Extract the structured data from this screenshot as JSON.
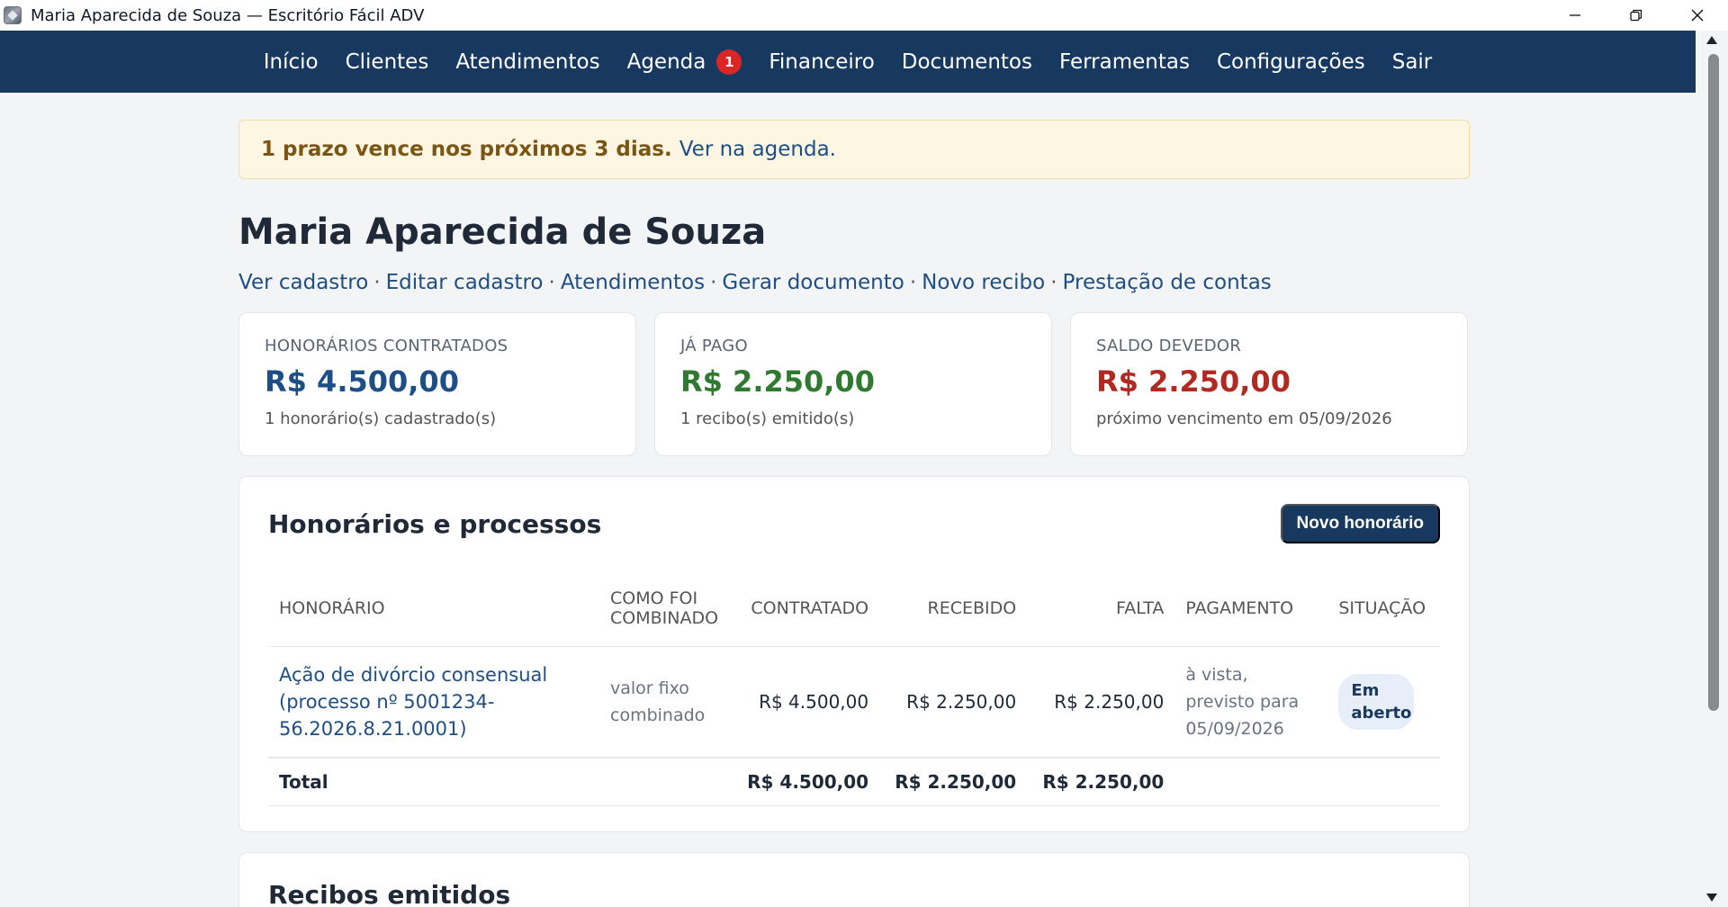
{
  "window": {
    "title": "Maria Aparecida de Souza — Escritório Fácil ADV"
  },
  "nav": {
    "items": [
      "Início",
      "Clientes",
      "Atendimentos",
      "Agenda",
      "Financeiro",
      "Documentos",
      "Ferramentas",
      "Configurações",
      "Sair"
    ],
    "agenda_badge": "1"
  },
  "alert": {
    "strong": "1 prazo vence nos próximos 3 dias.",
    "link": "Ver na agenda."
  },
  "client": {
    "name": "Maria Aparecida de Souza"
  },
  "actions": [
    "Ver cadastro",
    "Editar cadastro",
    "Atendimentos",
    "Gerar documento",
    "Novo recibo",
    "Prestação de contas"
  ],
  "cards": [
    {
      "label": "HONORÁRIOS CONTRATADOS",
      "value": "R$ 4.500,00",
      "sub": "1 honorário(s) cadastrado(s)"
    },
    {
      "label": "JÁ PAGO",
      "value": "R$ 2.250,00",
      "sub": "1 recibo(s) emitido(s)"
    },
    {
      "label": "SALDO DEVEDOR",
      "value": "R$ 2.250,00",
      "sub": "próximo vencimento em 05/09/2026"
    }
  ],
  "honorarios": {
    "title": "Honorários e processos",
    "new_button": "Novo honorário",
    "columns": [
      "HONORÁRIO",
      "COMO FOI COMBINADO",
      "CONTRATADO",
      "RECEBIDO",
      "FALTA",
      "PAGAMENTO",
      "SITUAÇÃO"
    ],
    "rows": [
      {
        "honorario": "Ação de divórcio consensual (processo nº 5001234-56.2026.8.21.0001)",
        "combinado": "valor fixo combinado",
        "contratado": "R$ 4.500,00",
        "recebido": "R$ 2.250,00",
        "falta": "R$ 2.250,00",
        "pagamento": "à vista, previsto para 05/09/2026",
        "situacao": "Em aberto"
      }
    ],
    "total": {
      "label": "Total",
      "contratado": "R$ 4.500,00",
      "recebido": "R$ 2.250,00",
      "falta": "R$ 2.250,00"
    }
  },
  "recibos": {
    "title": "Recibos emitidos"
  },
  "colors": {
    "nav_bg": "#17395f",
    "link": "#1e4e86",
    "paid_green": "#2f7a30",
    "debt_red": "#b02a22",
    "alert_bg": "#fdf6e3",
    "badge_red": "#dc2626"
  }
}
